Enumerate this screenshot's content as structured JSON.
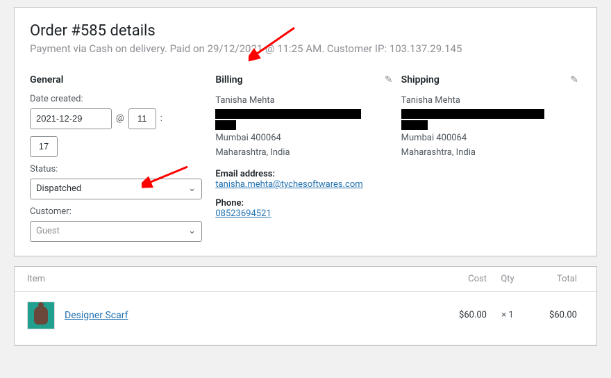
{
  "header": {
    "title": "Order #585 details",
    "subtitle": "Payment via Cash on delivery. Paid on 29/12/2021 @ 11:25 AM. Customer IP: 103.137.29.145"
  },
  "general": {
    "heading": "General",
    "date_created_label": "Date created:",
    "date": "2021-12-29",
    "at_symbol": "@",
    "hour": "11",
    "minute": "17",
    "status_label": "Status:",
    "status_value": "Dispatched",
    "customer_label": "Customer:",
    "customer_value": "Guest"
  },
  "billing": {
    "heading": "Billing",
    "name": "Tanisha Mehta",
    "citypost": "Mumbai 400064",
    "region": "Maharashtra, India",
    "email_label": "Email address:",
    "email": "tanisha.mehta@tychesoftwares.com",
    "phone_label": "Phone:",
    "phone": "08523694521"
  },
  "shipping": {
    "heading": "Shipping",
    "name": "Tanisha Mehta",
    "citypost": "Mumbai 400064",
    "region": "Maharashtra, India"
  },
  "items": {
    "head": {
      "item": "Item",
      "cost": "Cost",
      "qty": "Qty",
      "total": "Total"
    },
    "rows": [
      {
        "name": "Designer Scarf",
        "cost": "$60.00",
        "qty": "× 1",
        "total": "$60.00"
      }
    ]
  },
  "icons": {
    "pencil": "✎",
    "chevron": "⌄"
  }
}
